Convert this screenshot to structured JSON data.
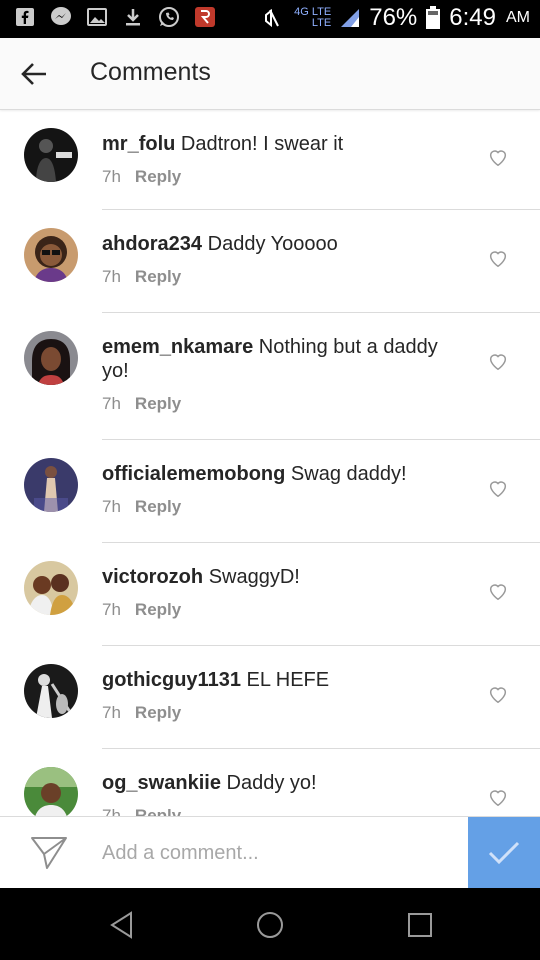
{
  "status_bar": {
    "network": "4G LTE",
    "network_sub": "LTE",
    "battery": "76%",
    "time": "6:49",
    "ampm": "AM",
    "left_icons": [
      "facebook-icon",
      "messenger-icon",
      "gallery-icon",
      "download-icon",
      "whatsapp-icon",
      "app-notification-icon"
    ]
  },
  "header": {
    "title": "Comments"
  },
  "comments": [
    {
      "username": "mr_folu",
      "text": "Dadtron! I swear it",
      "time": "7h",
      "reply": "Reply",
      "avatar_color": "#1a1a1a"
    },
    {
      "username": "ahdora234",
      "text": "Daddy Yooooo",
      "time": "7h",
      "reply": "Reply",
      "avatar_color": "#7a4a2a"
    },
    {
      "username": "emem_nkamare",
      "text": "Nothing but a daddy yo!",
      "time": "7h",
      "reply": "Reply",
      "avatar_color": "#3a2a2a"
    },
    {
      "username": "officialememobong",
      "text": "Swag daddy!",
      "time": "7h",
      "reply": "Reply",
      "avatar_color": "#5a5a8a"
    },
    {
      "username": "victorozoh",
      "text": "SwaggyD!",
      "time": "7h",
      "reply": "Reply",
      "avatar_color": "#b08040"
    },
    {
      "username": "gothicguy1131",
      "text": "EL HEFE",
      "time": "7h",
      "reply": "Reply",
      "avatar_color": "#2a2a2a"
    },
    {
      "username": "og_swankiie",
      "text": "Daddy yo!",
      "time": "7h",
      "reply": "Reply",
      "avatar_color": "#5a8a3a"
    }
  ],
  "composer": {
    "placeholder": "Add a comment..."
  },
  "colors": {
    "accent": "#4a90e2",
    "text": "#262626",
    "muted": "#8e8e8e",
    "divider": "#dbdbdb"
  }
}
